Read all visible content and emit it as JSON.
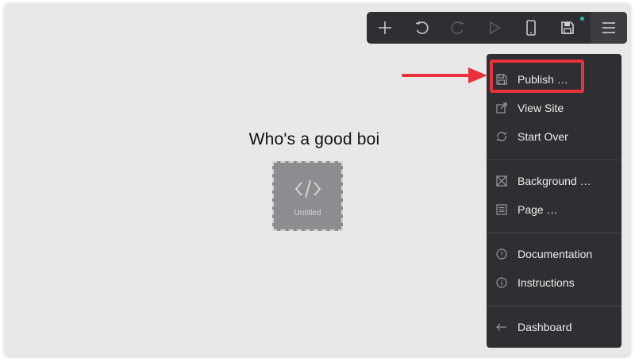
{
  "canvas": {
    "heading": "Who's a good boi",
    "embed_caption": "Untitled"
  },
  "toolbar": {
    "buttons": [
      "add",
      "undo",
      "redo",
      "play",
      "mobile-preview",
      "save",
      "menu"
    ],
    "unsaved_dot_color": "#25c2a0"
  },
  "menu": {
    "items": [
      {
        "label": "Publish …",
        "icon": "floppy-icon"
      },
      {
        "label": "View Site",
        "icon": "external-link-icon"
      },
      {
        "label": "Start Over",
        "icon": "refresh-icon"
      },
      {
        "label": "Background …",
        "icon": "background-image-icon"
      },
      {
        "label": "Page …",
        "icon": "page-icon"
      },
      {
        "label": "Documentation",
        "icon": "help-circle-icon"
      },
      {
        "label": "Instructions",
        "icon": "info-circle-icon"
      },
      {
        "label": "Dashboard",
        "icon": "arrow-left-icon"
      }
    ]
  },
  "annotation": {
    "arrow_color": "#e8313a",
    "highlight_target": "Publish …"
  }
}
